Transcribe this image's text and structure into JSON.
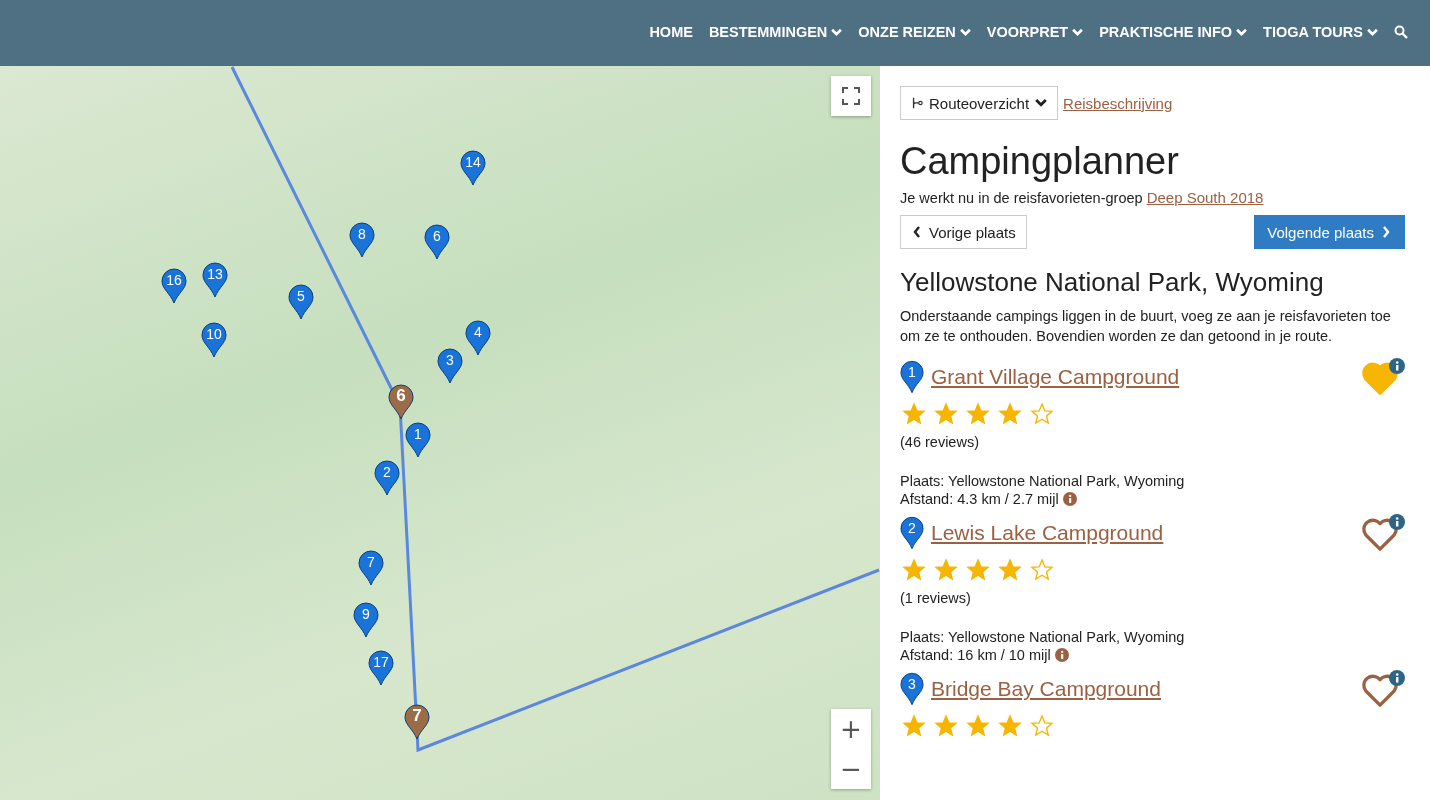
{
  "nav": {
    "items": [
      {
        "label": "HOME",
        "dropdown": false
      },
      {
        "label": "BESTEMMINGEN",
        "dropdown": true
      },
      {
        "label": "ONZE REIZEN",
        "dropdown": true
      },
      {
        "label": "VOORPRET",
        "dropdown": true
      },
      {
        "label": "PRAKTISCHE INFO",
        "dropdown": true
      },
      {
        "label": "TIOGA TOURS",
        "dropdown": true
      }
    ]
  },
  "map": {
    "pins": [
      {
        "label": "14",
        "kind": "campground"
      },
      {
        "label": "8",
        "kind": "campground"
      },
      {
        "label": "6",
        "kind": "campground"
      },
      {
        "label": "16",
        "kind": "campground"
      },
      {
        "label": "13",
        "kind": "campground"
      },
      {
        "label": "5",
        "kind": "campground"
      },
      {
        "label": "10",
        "kind": "campground"
      },
      {
        "label": "4",
        "kind": "campground"
      },
      {
        "label": "3",
        "kind": "campground"
      },
      {
        "label": "6",
        "kind": "stop"
      },
      {
        "label": "1",
        "kind": "campground"
      },
      {
        "label": "2",
        "kind": "campground"
      },
      {
        "label": "7",
        "kind": "campground"
      },
      {
        "label": "9",
        "kind": "campground"
      },
      {
        "label": "17",
        "kind": "campground"
      },
      {
        "label": "7",
        "kind": "stop"
      }
    ],
    "zoom_in": "+",
    "zoom_out": "−"
  },
  "panel": {
    "route_dropdown": "Routeoverzicht",
    "description_link": "Reisbeschrijving",
    "title": "Campingplanner",
    "group_text": "Je werkt nu in de reisfavorieten-groep",
    "group_link": "Deep South 2018",
    "prev_button": "Vorige plaats",
    "next_button": "Volgende plaats",
    "place_title": "Yellowstone National Park, Wyoming",
    "intro": "Onderstaande campings liggen in de buurt, voeg ze aan je reisfavorieten toe om ze te onthouden. Bovendien worden ze dan getoond in je route.",
    "campgrounds": [
      {
        "number": "1",
        "name": "Grant Village Campground",
        "stars": 4,
        "reviews": "(46 reviews)",
        "place": "Plaats: Yellowstone National Park, Wyoming",
        "distance": "Afstand: 4.3 km / 2.7 mijl",
        "favorite": true
      },
      {
        "number": "2",
        "name": "Lewis Lake Campground",
        "stars": 4,
        "reviews": "(1 reviews)",
        "place": "Plaats: Yellowstone National Park, Wyoming",
        "distance": "Afstand: 16 km / 10 mijl",
        "favorite": false
      },
      {
        "number": "3",
        "name": "Bridge Bay Campground",
        "stars": 4,
        "favorite": false
      }
    ]
  }
}
